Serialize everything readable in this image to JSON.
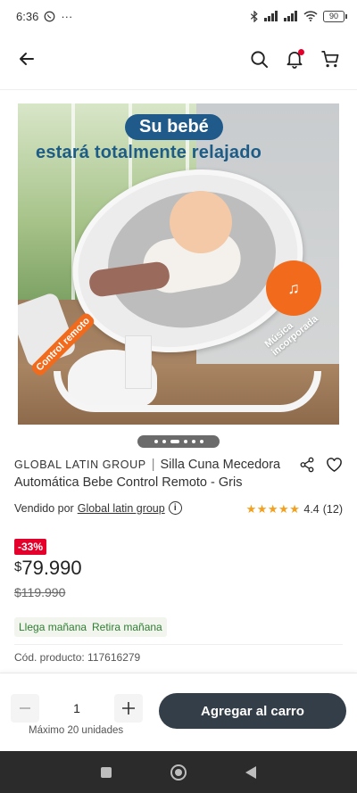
{
  "status_bar": {
    "time": "6:36",
    "left_icons": [
      "whatsapp-icon",
      "more-dots-icon"
    ],
    "right_icons": [
      "bluetooth-icon",
      "signal-icon",
      "signal-icon",
      "wifi-icon"
    ],
    "battery": "90"
  },
  "app_bar": {
    "icons": [
      "back-arrow-icon",
      "search-icon",
      "notification-bell-icon",
      "cart-icon"
    ],
    "notification_dot_color": "#e4002b"
  },
  "hero": {
    "headline_pill": "Su bebé",
    "headline_line2": "estará totalmente relajado",
    "remote_label": "Control remoto",
    "music_label": "Música incorporada",
    "pager_total": 6,
    "pager_active": 3
  },
  "product": {
    "brand": "GLOBAL LATIN GROUP",
    "separator": "|",
    "title": "Silla Cuna Mecedora Automática Bebe Control Remoto - Gris",
    "seller_prefix": "Vendido por",
    "seller_name": "Global latin group",
    "rating_value": "4.4",
    "rating_count": "(12)",
    "rating_stars": 4.4,
    "discount": "-33%",
    "price_currency": "$",
    "price": "79.990",
    "old_price": "$119.990",
    "delivery_tag": "Llega mañana",
    "pickup_tag": "Retira mañana",
    "sku": "Cód. producto: 117616279"
  },
  "purchase": {
    "quantity": "1",
    "max_label": "Máximo 20 unidades",
    "add_to_cart": "Agregar al carro",
    "button_color": "#343e48"
  },
  "colors": {
    "discount_bg": "#e4002b",
    "tag_text": "#2f7d32",
    "star": "#f2a01e"
  }
}
